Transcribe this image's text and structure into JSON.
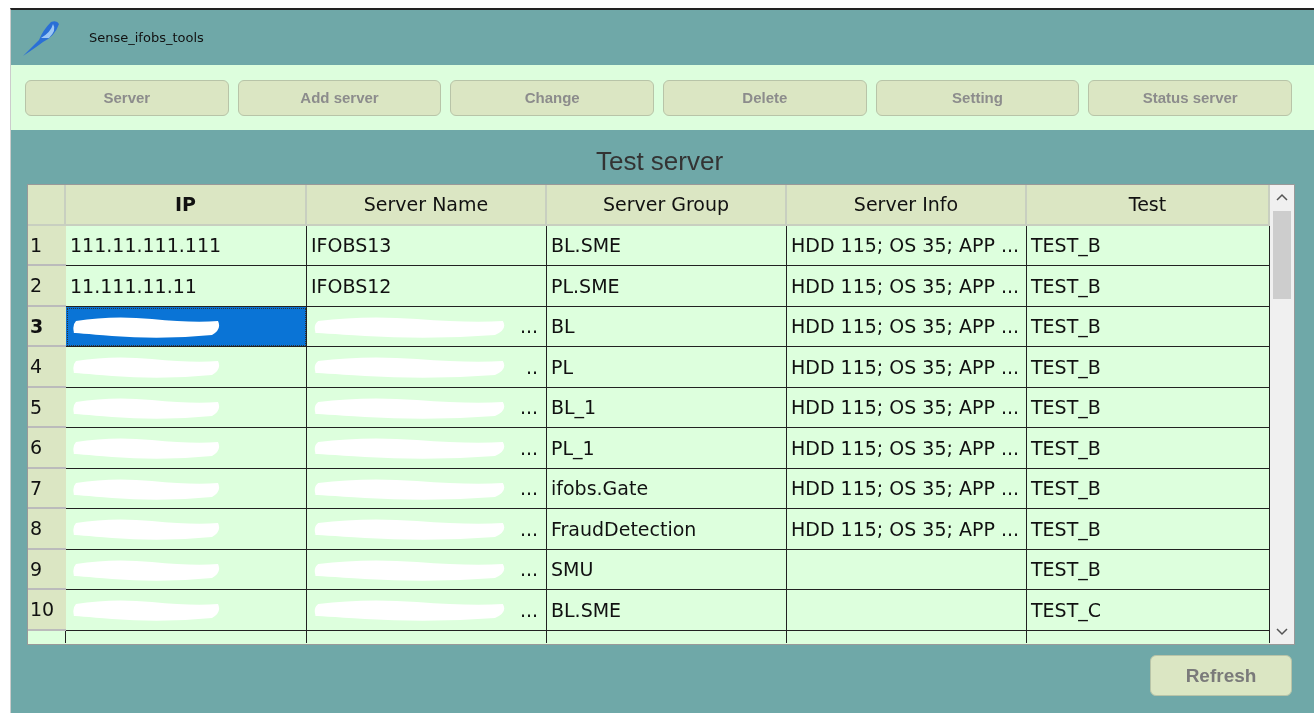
{
  "window": {
    "title": "Sense_ifobs_tools"
  },
  "toolbar": [
    {
      "label": "Server",
      "disabled": true
    },
    {
      "label": "Add server",
      "disabled": true
    },
    {
      "label": "Change",
      "disabled": true
    },
    {
      "label": "Delete",
      "disabled": true
    },
    {
      "label": "Setting",
      "disabled": true
    },
    {
      "label": "Status server",
      "disabled": true
    }
  ],
  "heading": "Test server",
  "table": {
    "columns": [
      "IP",
      "Server Name",
      "Server Group",
      "Server Info",
      "Test"
    ],
    "rows": [
      {
        "number": "1",
        "selected": false,
        "ip": "111.11.111.111",
        "name": "IFOBS13",
        "group": "BL.SME",
        "info": "HDD 115; OS 35; APP ...",
        "test": "TEST_B"
      },
      {
        "number": "2",
        "selected": false,
        "ip": "11.111.11.11",
        "name": "IFOBS12",
        "group": "PL.SME",
        "info": "HDD 115; OS 35; APP ...",
        "test": "TEST_B"
      },
      {
        "number": "3",
        "selected": true,
        "ip_redacted": true,
        "name": "...",
        "name_redacted": true,
        "group": "BL",
        "info": "HDD 115; OS 35; APP ...",
        "test": "TEST_B"
      },
      {
        "number": "4",
        "selected": false,
        "ip_redacted": true,
        "name": "..",
        "name_redacted": true,
        "group": "PL",
        "info": "HDD 115; OS 35; APP ...",
        "test": "TEST_B"
      },
      {
        "number": "5",
        "selected": false,
        "ip_redacted": true,
        "name": "...",
        "name_redacted": true,
        "group": "BL_1",
        "info": "HDD 115; OS 35; APP ...",
        "test": "TEST_B"
      },
      {
        "number": "6",
        "selected": false,
        "ip_redacted": true,
        "name": "...",
        "name_redacted": true,
        "group": "PL_1",
        "info": "HDD 115; OS 35; APP ...",
        "test": "TEST_B"
      },
      {
        "number": "7",
        "selected": false,
        "ip_redacted": true,
        "name": "...",
        "name_redacted": true,
        "group": "ifobs.Gate",
        "info": "HDD 115; OS 35; APP ...",
        "test": "TEST_B"
      },
      {
        "number": "8",
        "selected": false,
        "ip_redacted": true,
        "name": "...",
        "name_redacted": true,
        "group": "FraudDetection",
        "info": "HDD 115; OS 35; APP ...",
        "test": "TEST_B"
      },
      {
        "number": "9",
        "selected": false,
        "ip_redacted": true,
        "name": "...",
        "name_redacted": true,
        "group": "SMU",
        "test": "TEST_B"
      },
      {
        "number": "10",
        "selected": false,
        "ip_redacted": true,
        "name": "...",
        "name_redacted": true,
        "group": "BL.SME",
        "test": "TEST_C"
      }
    ]
  },
  "refresh_button": {
    "label": "Refresh",
    "disabled": true
  }
}
